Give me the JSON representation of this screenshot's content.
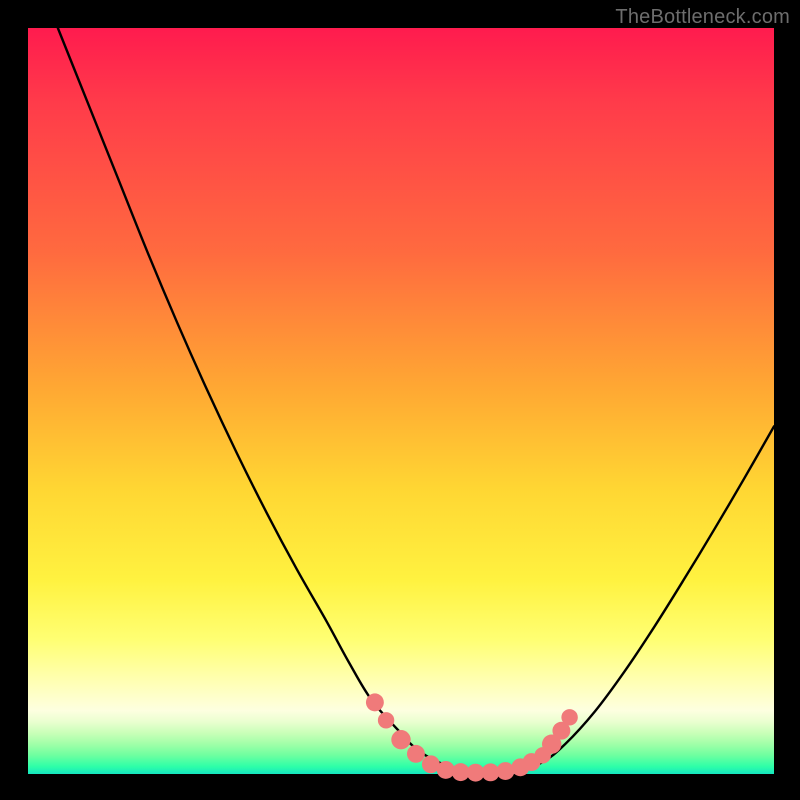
{
  "watermark": "TheBottleneck.com",
  "colors": {
    "frame": "#000000",
    "gradient_top": "#ff1b4e",
    "gradient_mid": "#ffd733",
    "gradient_bottom": "#14e6c0",
    "curve": "#000000",
    "marker_fill": "#f07a7a",
    "marker_stroke": "#e06868"
  },
  "chart_data": {
    "type": "line",
    "title": "",
    "xlabel": "",
    "ylabel": "",
    "xlim": [
      0,
      100
    ],
    "ylim": [
      0,
      100
    ],
    "grid": false,
    "legend": false,
    "series": [
      {
        "name": "bottleneck-curve",
        "x": [
          4,
          8,
          12,
          16,
          20,
          24,
          28,
          32,
          36,
          40,
          43,
          46,
          49.5,
          52,
          55,
          58,
          61,
          64,
          66,
          69,
          72,
          76,
          80,
          84,
          88,
          92,
          96,
          100
        ],
        "y": [
          100,
          90,
          80,
          70,
          60.5,
          51.5,
          43,
          35,
          27.5,
          20.5,
          15,
          10,
          6,
          3.4,
          1.6,
          0.6,
          0.2,
          0.2,
          0.6,
          1.6,
          4,
          8.4,
          13.8,
          19.8,
          26.2,
          32.8,
          39.6,
          46.6
        ]
      }
    ],
    "markers": [
      {
        "x": 46.5,
        "y": 9.6,
        "r": 1.2
      },
      {
        "x": 48.0,
        "y": 7.2,
        "r": 1.1
      },
      {
        "x": 50.0,
        "y": 4.6,
        "r": 1.3
      },
      {
        "x": 52.0,
        "y": 2.7,
        "r": 1.2
      },
      {
        "x": 54.0,
        "y": 1.3,
        "r": 1.2
      },
      {
        "x": 56.0,
        "y": 0.55,
        "r": 1.2
      },
      {
        "x": 58.0,
        "y": 0.25,
        "r": 1.2
      },
      {
        "x": 60.0,
        "y": 0.18,
        "r": 1.2
      },
      {
        "x": 62.0,
        "y": 0.22,
        "r": 1.2
      },
      {
        "x": 64.0,
        "y": 0.4,
        "r": 1.2
      },
      {
        "x": 66.0,
        "y": 0.9,
        "r": 1.2
      },
      {
        "x": 67.5,
        "y": 1.6,
        "r": 1.2
      },
      {
        "x": 69.0,
        "y": 2.5,
        "r": 1.1
      },
      {
        "x": 70.2,
        "y": 4.0,
        "r": 1.3
      },
      {
        "x": 71.5,
        "y": 5.8,
        "r": 1.2
      },
      {
        "x": 72.6,
        "y": 7.6,
        "r": 1.1
      }
    ]
  }
}
